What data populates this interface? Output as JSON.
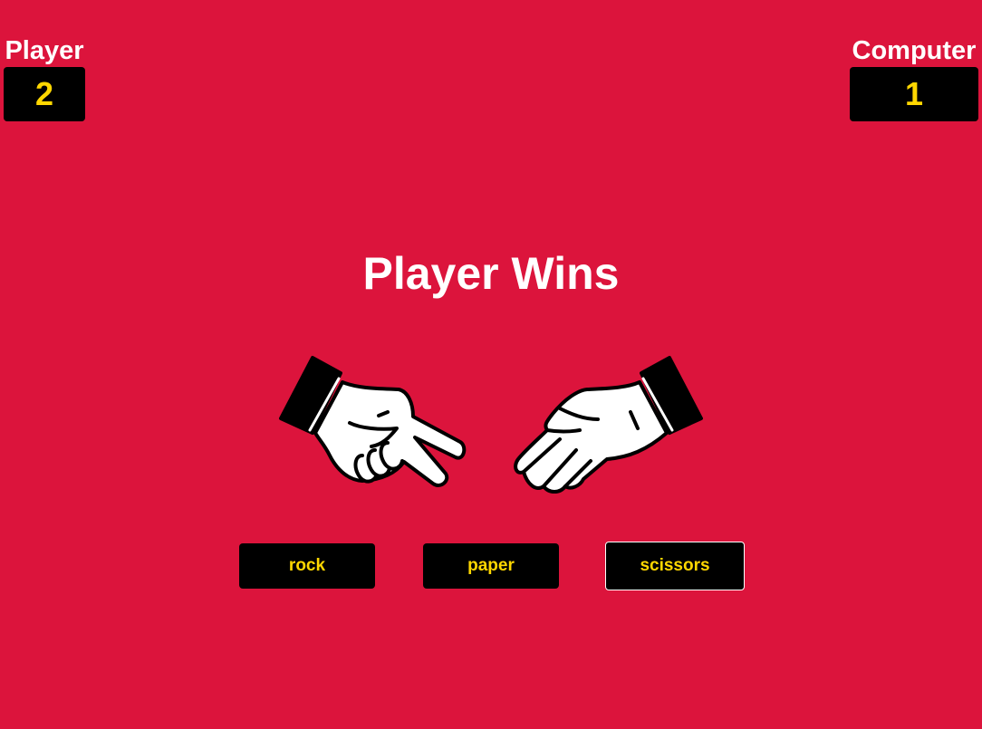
{
  "colors": {
    "background": "#dc143c",
    "label_text": "#ffffff",
    "score_text": "#ffd700",
    "button_bg": "#000000",
    "button_text": "#ffd700"
  },
  "scoreboard": {
    "player": {
      "label": "Player",
      "score": "2"
    },
    "computer": {
      "label": "Computer",
      "score": "1"
    }
  },
  "result": {
    "message": "Player Wins"
  },
  "hands": {
    "player_choice_icon": "scissors-hand-icon",
    "computer_choice_icon": "paper-hand-icon"
  },
  "choices": {
    "rock": "rock",
    "paper": "paper",
    "scissors": "scissors",
    "focused": "scissors"
  }
}
